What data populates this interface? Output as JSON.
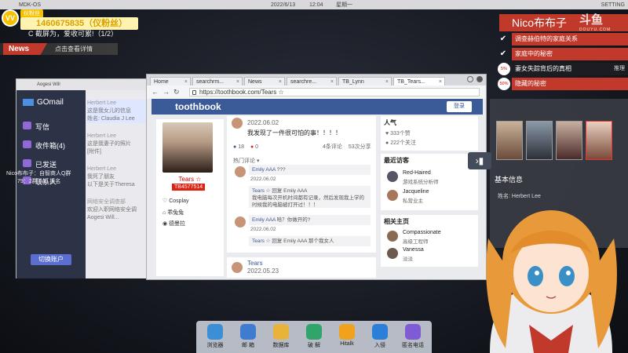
{
  "topbar": {
    "os_name": "MDK-OS",
    "date": "2022/6/13",
    "time": "12:04",
    "weekday": "星期一",
    "settings": "SETTING"
  },
  "overlay": {
    "fan_badge": "仪粉丝",
    "uid": "1460675835（仪粉丝）",
    "task_text": "C 截屏为，爱收可累!（1/2）",
    "news_label": "News",
    "news_text": "点击查看详情",
    "chat_line1": "Nico布布子：自智商人Q群",
    "chat_line2": "79：2群 (点) 报名"
  },
  "mail": {
    "window_user": "Aogesi Will",
    "app_name": "GOmail",
    "nav": [
      {
        "label": "写信"
      },
      {
        "label": "收件箱(4)"
      },
      {
        "label": "已发送"
      },
      {
        "label": "联系人"
      }
    ],
    "switch_account": "切换账户",
    "items": [
      {
        "from": "Herbert Lee",
        "line1": "这是我女儿的信息",
        "line2": "姓名: Claudia J Lee"
      },
      {
        "from": "Herbert Lee",
        "line1": "这是我妻子的照片",
        "line2": "[附件]"
      },
      {
        "from": "Herbert Lee",
        "line1": "我死了朋友",
        "line2": "以下是关于Theresa"
      },
      {
        "from": "网络安全调查部",
        "line1": "欢迎入职网络安全调",
        "line2": "Aogesi Will..."
      }
    ]
  },
  "browser": {
    "tabs": [
      "Home",
      "searchrm...",
      "News",
      "searchre...",
      "TB_Lynn",
      "TB_Tears..."
    ],
    "url": "https://toothbook.com/Tears ☆",
    "site_name": "toothbook",
    "login": "登录",
    "profile": {
      "name": "Tears ☆",
      "id": "TB4577514",
      "links": [
        "Cosplay",
        "乖兔兔",
        "德曼拉"
      ]
    },
    "post1": {
      "date": "2022.06.02",
      "text": "我发现了一件很可怕的事！！！！",
      "likes": "18",
      "dislikes": "0",
      "comments": "4条评论",
      "shares": "53次分享",
      "hot_label": "热门评论"
    },
    "comments": [
      {
        "name": "Emily AAA",
        "text": "???",
        "date": "2022.06.02"
      },
      {
        "name": "Tears ☆",
        "reply": "回复 Emily AAA",
        "text": "我电脑每次开机时间都有记录，然后发现我上学的时候我的电脑被打开过！！！"
      },
      {
        "name": "Emily AAA",
        "text": "哈？你做开的?",
        "date": "2022.06.02"
      },
      {
        "name": "Tears ☆",
        "reply": "回复 Emily AAA",
        "text": "那个我女人"
      }
    ],
    "post2": {
      "name": "Tears",
      "date": "2022.05.23"
    },
    "popularity": {
      "title": "人气",
      "likes": "333个赞",
      "follows": "222个关注"
    },
    "recent": {
      "title": "最近访客",
      "people": [
        {
          "name": "Red-Haired",
          "role": "游戏系统分析师"
        },
        {
          "name": "Jacqueline",
          "role": "私营业主"
        }
      ]
    },
    "related": {
      "title": "相关主页",
      "people": [
        {
          "name": "Compassionate",
          "role": "高级工程师"
        },
        {
          "name": "Vanessa",
          "role": "淡淡"
        }
      ]
    }
  },
  "quest_panel": {
    "stream_name": "Nico布布子",
    "watermark": "斗鱼",
    "watermark_sub": "DOUYU.COM",
    "items": [
      {
        "label": "调查赫伯特的家庭关系",
        "status": "done"
      },
      {
        "label": "家庭中的秘密",
        "status": "done"
      },
      {
        "label": "妻女失踪背后的真相",
        "status": "5%",
        "hint": "推理"
      },
      {
        "label": "隐藏的秘密",
        "status": "50%"
      }
    ],
    "basic_info": "基本信息",
    "name_label": "姓名: Herbert Lee"
  },
  "dock": {
    "items": [
      {
        "label": "浏览器",
        "color": "#3a8fd6"
      },
      {
        "label": "邮 箱",
        "color": "#3f7bd0"
      },
      {
        "label": "数据库",
        "color": "#e8b33a"
      },
      {
        "label": "破 解",
        "color": "#2fa56b"
      },
      {
        "label": "Hitalk",
        "color": "#f0a21c"
      },
      {
        "label": "入侵",
        "color": "#2b7fd8"
      },
      {
        "label": "匿名电话",
        "color": "#7f5cd6"
      }
    ]
  },
  "colors": {
    "accent_red": "#c0392b",
    "site_blue": "#3b5a98",
    "mail_dark": "#2c3347",
    "badge_yellow": "#f4c000"
  }
}
